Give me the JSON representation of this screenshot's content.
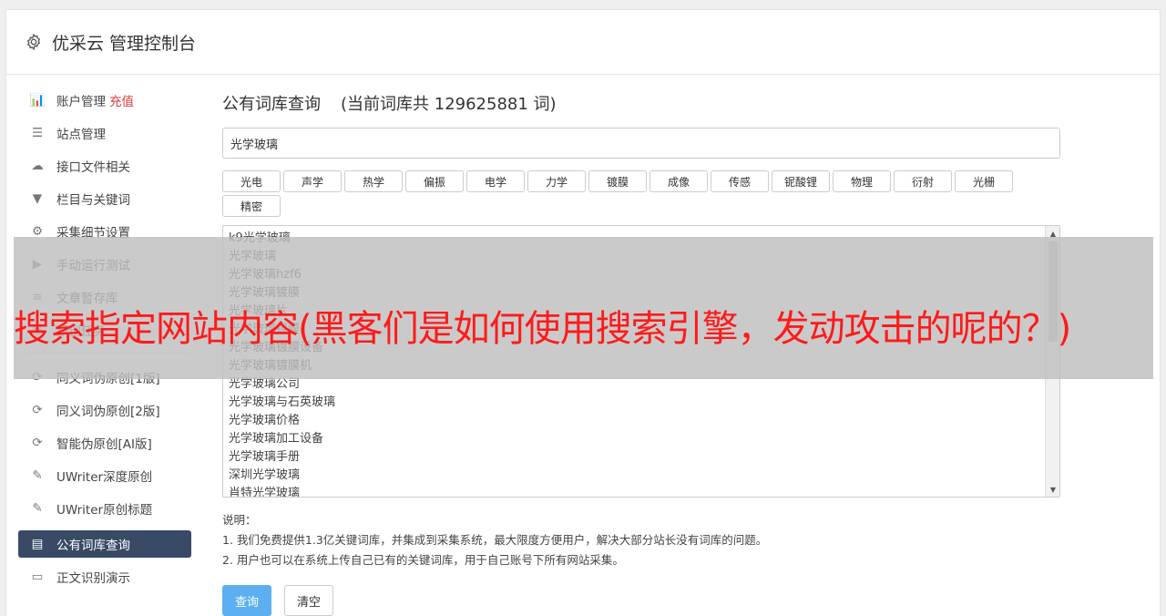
{
  "header": {
    "title": "优采云 管理控制台",
    "icon": "gear-icon"
  },
  "sidebar": {
    "group1": [
      {
        "label": "账户管理",
        "badge": "充值",
        "icon": "bar-chart-icon",
        "glyph": "📊"
      },
      {
        "label": "站点管理",
        "icon": "server-icon",
        "glyph": "☰"
      },
      {
        "label": "接口文件相关",
        "icon": "cloud-upload-icon",
        "glyph": "☁"
      },
      {
        "label": "栏目与关键词",
        "icon": "filter-icon",
        "glyph": "▼"
      },
      {
        "label": "采集细节设置",
        "icon": "cogs-icon",
        "glyph": "⚙"
      },
      {
        "label": "手动运行测试",
        "icon": "play-circle-icon",
        "glyph": "▶"
      },
      {
        "label": "文章暂存库",
        "icon": "database-icon",
        "glyph": "≡"
      },
      {
        "label": "原创任务",
        "icon": "task-icon",
        "glyph": "◉"
      }
    ],
    "group2": [
      {
        "label": "同义词伪原创[1版]",
        "icon": "refresh-icon",
        "glyph": "⟳"
      },
      {
        "label": "同义词伪原创[2版]",
        "icon": "refresh-icon",
        "glyph": "⟳"
      },
      {
        "label": "智能伪原创[AI版]",
        "icon": "refresh-icon",
        "glyph": "⟳"
      },
      {
        "label": "UWriter深度原创",
        "icon": "edit-icon",
        "glyph": "✎"
      },
      {
        "label": "UWriter原创标题",
        "icon": "edit-icon",
        "glyph": "✎"
      }
    ],
    "active": {
      "label": "公有词库查询",
      "icon": "book-icon",
      "glyph": "▤"
    },
    "group3": [
      {
        "label": "正文识别演示",
        "icon": "desktop-icon",
        "glyph": "▭"
      }
    ]
  },
  "main": {
    "title": "公有词库查询",
    "count_text": "(当前词库共 129625881 词)",
    "search": {
      "value": "光学玻璃",
      "placeholder": ""
    },
    "tags": [
      "光电",
      "声学",
      "热学",
      "偏振",
      "电学",
      "力学",
      "镀膜",
      "成像",
      "传感",
      "铌酸锂",
      "物理",
      "衍射",
      "光栅",
      "精密"
    ],
    "words": [
      "k9光学玻璃",
      "光学玻璃",
      "光学玻璃hzf6",
      "光学玻璃镀膜",
      "光学玻璃片",
      "光学玻璃镀膜",
      "光学玻璃镀膜设备",
      "光学玻璃镀膜机",
      "光学玻璃公司",
      "光学玻璃与石英玻璃",
      "光学玻璃价格",
      "光学玻璃加工设备",
      "光学玻璃手册",
      "深圳光学玻璃",
      "肖特光学玻璃"
    ],
    "notes_title": "说明：",
    "notes": [
      "1. 我们免费提供1.3亿关键词库，并集成到采集系统，最大限度方便用户，解决大部分站长没有词库的问题。",
      "2. 用户也可以在系统上传自己已有的关键词库，用于自己账号下所有网站采集。"
    ],
    "query_button": "查询",
    "clear_button": "清空"
  },
  "overlay": {
    "text": "搜索指定网站内容(黑客们是如何使用搜索引擎，发动攻击的呢的？)"
  }
}
